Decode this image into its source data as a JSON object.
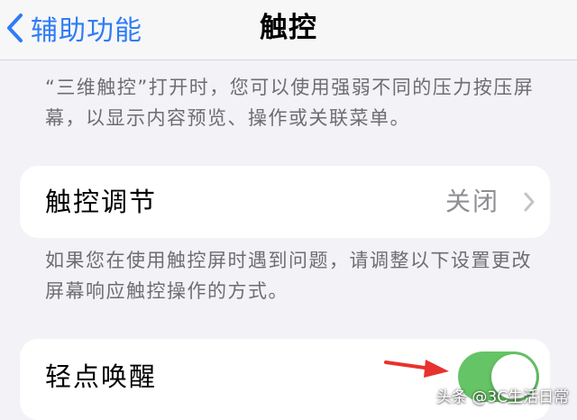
{
  "nav": {
    "back_label": "辅助功能",
    "title": "触控"
  },
  "footnote_3d_touch": "“三维触控”打开时，您可以使用强弱不同的压力按压屏幕，以显示内容预览、操作或关联菜单。",
  "touch_accommodations": {
    "label": "触控调节",
    "value": "关闭"
  },
  "footnote_accommodations": "如果您在使用触控屏时遇到问题，请调整以下设置更改屏幕响应触控操作的方式。",
  "tap_to_wake": {
    "label": "轻点唤醒",
    "enabled": true
  },
  "watermark": "头条 @3C生活日常",
  "colors": {
    "accent": "#2f7cf6",
    "toggle_on": "#65c466",
    "annotation_arrow": "#e8322d"
  },
  "icons": {
    "back": "chevron-left-icon",
    "disclosure": "chevron-right-icon",
    "annotation": "red-arrow-icon"
  }
}
